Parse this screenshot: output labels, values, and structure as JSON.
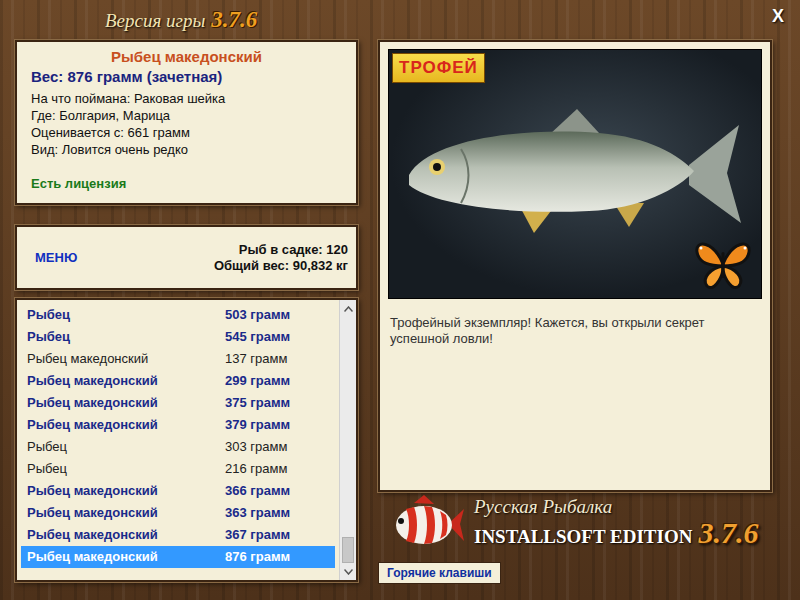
{
  "window": {
    "title_prefix": "Версия игры",
    "title_version": "3.7.6",
    "close": "X"
  },
  "fish": {
    "name": "Рыбец македонский",
    "weight": "Вес: 876 грамм (зачетная)",
    "details": [
      "На что поймана: Раковая шейка",
      "Где: Болгария, Марица",
      "Оценивается с: 661 грамм",
      "Вид: Ловится очень редко"
    ],
    "license": "Есть лицензия"
  },
  "summary": {
    "menu": "МЕНЮ",
    "count": "Рыб в садке: 120",
    "total": "Общий вес: 90,832 кг"
  },
  "catch_list": [
    {
      "name": "Рыбец",
      "weight": "503 грамм",
      "counted": true,
      "selected": false
    },
    {
      "name": "Рыбец",
      "weight": "545 грамм",
      "counted": true,
      "selected": false
    },
    {
      "name": "Рыбец македонский",
      "weight": "137 грамм",
      "counted": false,
      "selected": false
    },
    {
      "name": "Рыбец македонский",
      "weight": "299 грамм",
      "counted": true,
      "selected": false
    },
    {
      "name": "Рыбец македонский",
      "weight": "375 грамм",
      "counted": true,
      "selected": false
    },
    {
      "name": "Рыбец македонский",
      "weight": "379 грамм",
      "counted": true,
      "selected": false
    },
    {
      "name": "Рыбец",
      "weight": "303 грамм",
      "counted": false,
      "selected": false
    },
    {
      "name": "Рыбец",
      "weight": "216 грамм",
      "counted": false,
      "selected": false
    },
    {
      "name": "Рыбец македонский",
      "weight": "366 грамм",
      "counted": true,
      "selected": false
    },
    {
      "name": "Рыбец македонский",
      "weight": "363 грамм",
      "counted": true,
      "selected": false
    },
    {
      "name": "Рыбец македонский",
      "weight": "367 грамм",
      "counted": true,
      "selected": false
    },
    {
      "name": "Рыбец македонский",
      "weight": "876 грамм",
      "counted": true,
      "selected": true
    }
  ],
  "scrollbar": {
    "level": 1
  },
  "photo": {
    "badge": "ТРОФЕЙ"
  },
  "message": "Трофейный экземпляр! Кажется, вы открыли секрет успешной ловли!",
  "logo": {
    "title": "Русская Рыбалка",
    "edition": "INSTALLSOFT EDITION",
    "version": "3.7.6"
  },
  "hotkeys": "Горячие клавиши"
}
